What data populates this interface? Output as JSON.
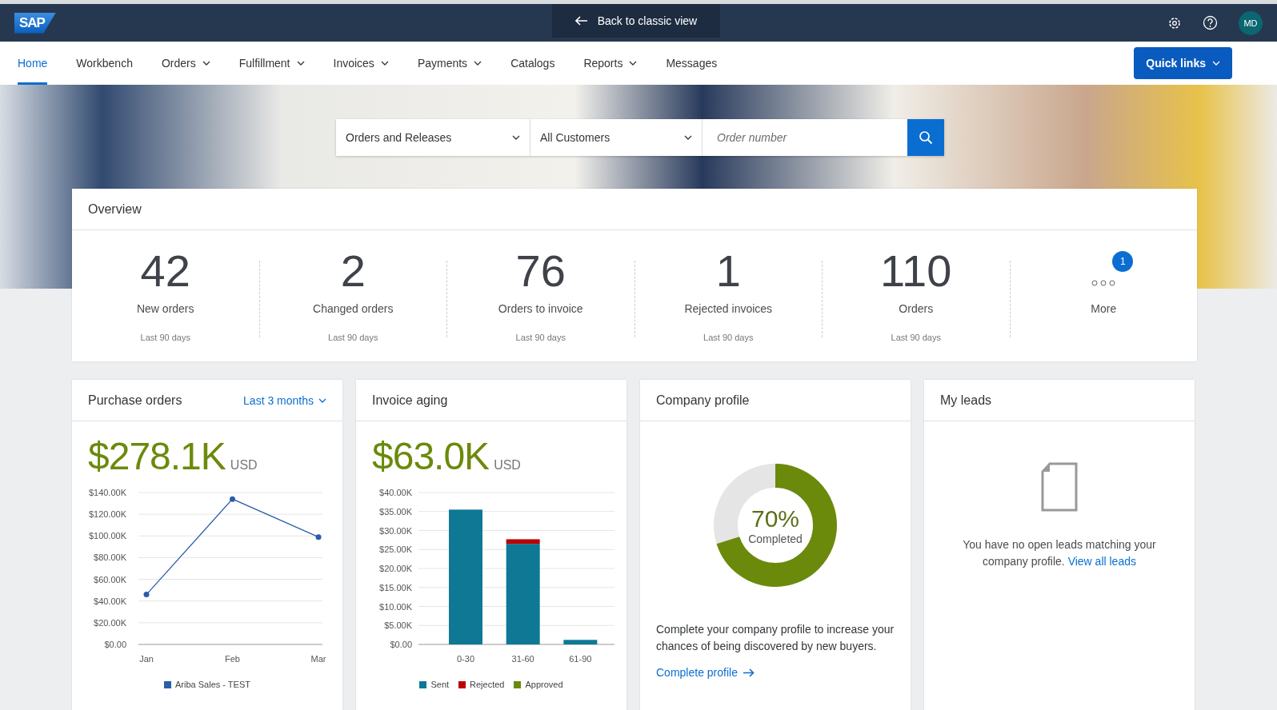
{
  "header": {
    "logo": "SAP",
    "back_button": "Back to classic view",
    "avatar": "MD"
  },
  "nav": {
    "items": [
      {
        "label": "Home",
        "selected": true,
        "has_menu": false
      },
      {
        "label": "Workbench",
        "selected": false,
        "has_menu": false
      },
      {
        "label": "Orders",
        "selected": false,
        "has_menu": true
      },
      {
        "label": "Fulfillment",
        "selected": false,
        "has_menu": true
      },
      {
        "label": "Invoices",
        "selected": false,
        "has_menu": true
      },
      {
        "label": "Payments",
        "selected": false,
        "has_menu": true
      },
      {
        "label": "Catalogs",
        "selected": false,
        "has_menu": false
      },
      {
        "label": "Reports",
        "selected": false,
        "has_menu": true
      },
      {
        "label": "Messages",
        "selected": false,
        "has_menu": false
      }
    ],
    "quick_links": "Quick links"
  },
  "search": {
    "document_type": "Orders and Releases",
    "customer": "All Customers",
    "placeholder": "Order number"
  },
  "overview": {
    "title": "Overview",
    "items": [
      {
        "kind": "stat",
        "value": "42",
        "label": "New orders",
        "period": "Last 90 days"
      },
      {
        "kind": "stat",
        "value": "2",
        "label": "Changed orders",
        "period": "Last 90 days"
      },
      {
        "kind": "stat",
        "value": "76",
        "label": "Orders to invoice",
        "period": "Last 90 days"
      },
      {
        "kind": "stat",
        "value": "1",
        "label": "Rejected invoices",
        "period": "Last 90 days"
      },
      {
        "kind": "stat",
        "value": "110",
        "label": "Orders",
        "period": "Last 90 days"
      },
      {
        "kind": "more",
        "badge": "1",
        "label": "More"
      }
    ]
  },
  "purchase_orders": {
    "title": "Purchase orders",
    "period": "Last 3 months",
    "amount": "$278.1K",
    "currency": "USD",
    "chart_data": {
      "type": "line",
      "categories": [
        "Jan",
        "Feb",
        "Mar"
      ],
      "series": [
        {
          "name": "Ariba Sales - TEST",
          "color": "#2b5ea8",
          "marker": true,
          "values": [
            46,
            134,
            99
          ]
        }
      ],
      "grid": true,
      "ylim": [
        0,
        140
      ],
      "yticks": [
        {
          "value": 0,
          "label": "$0.00"
        },
        {
          "value": 20,
          "label": "$20.00K"
        },
        {
          "value": 40,
          "label": "$40.00K"
        },
        {
          "value": 60,
          "label": "$60.00K"
        },
        {
          "value": 80,
          "label": "$80.00K"
        },
        {
          "value": 100,
          "label": "$100.00K"
        },
        {
          "value": 120,
          "label": "$120.00K"
        },
        {
          "value": 140,
          "label": "$140.00K"
        }
      ]
    }
  },
  "invoice_aging": {
    "title": "Invoice aging",
    "amount": "$63.0K",
    "currency": "USD",
    "chart_data": {
      "type": "bar",
      "stacked": true,
      "grid": true,
      "categories": [
        "0-30",
        "31-60",
        "61-90"
      ],
      "series": [
        {
          "name": "Sent",
          "color": "#0e7895",
          "values": [
            35.5,
            26.5,
            1.2
          ]
        },
        {
          "name": "Rejected",
          "color": "#bb0000",
          "values": [
            0,
            1.2,
            0
          ]
        },
        {
          "name": "Approved",
          "color": "#6b8a0b",
          "values": [
            0,
            0,
            0
          ]
        }
      ],
      "ylim": [
        0,
        40
      ],
      "yticks": [
        {
          "value": 0,
          "label": "$0.00"
        },
        {
          "value": 5,
          "label": "$5.00K"
        },
        {
          "value": 10,
          "label": "$10.00K"
        },
        {
          "value": 15,
          "label": "$15.00K"
        },
        {
          "value": 20,
          "label": "$20.00K"
        },
        {
          "value": 25,
          "label": "$25.00K"
        },
        {
          "value": 30,
          "label": "$30.00K"
        },
        {
          "value": 35,
          "label": "$35.00K"
        },
        {
          "value": 40,
          "label": "$40.00K"
        }
      ]
    }
  },
  "company_profile": {
    "title": "Company profile",
    "level": 0.7,
    "percent": "70%",
    "status": "Completed",
    "text": "Complete your company profile to increase your chances of being discovered by new buyers.",
    "link": "Complete profile"
  },
  "my_leads": {
    "title": "My leads",
    "message": "You have no open leads matching your company profile.",
    "link": "View all leads"
  }
}
